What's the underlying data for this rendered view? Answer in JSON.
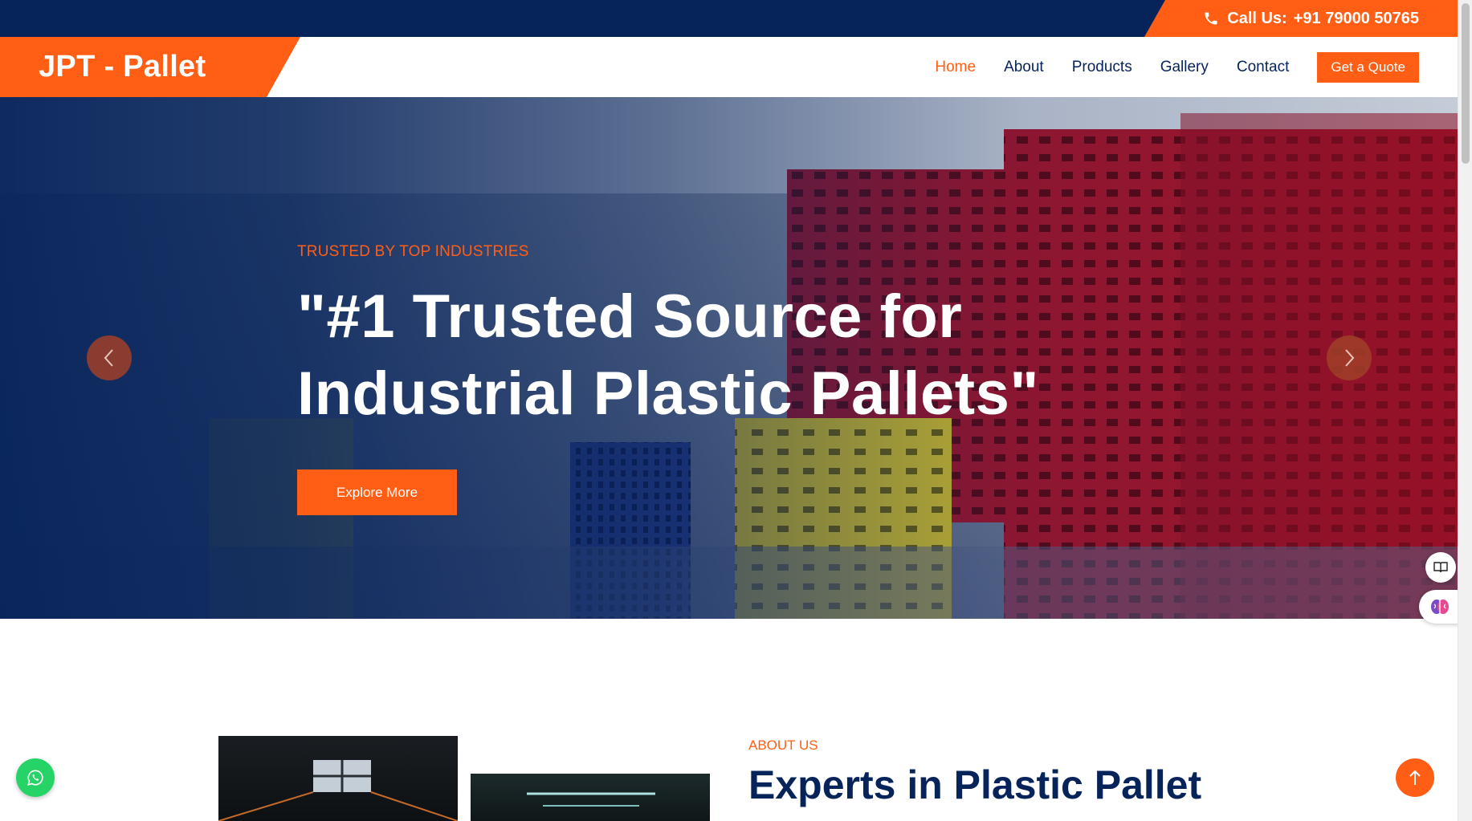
{
  "topbar": {
    "call_label": "Call Us:",
    "phone": "+91 79000 50765",
    "phone_icon": "phone-icon"
  },
  "brand": {
    "name": "JPT - Pallet"
  },
  "nav": {
    "items": [
      {
        "label": "Home",
        "active": true
      },
      {
        "label": "About",
        "active": false
      },
      {
        "label": "Products",
        "active": false
      },
      {
        "label": "Gallery",
        "active": false
      },
      {
        "label": "Contact",
        "active": false
      }
    ],
    "cta": "Get a Quote"
  },
  "hero": {
    "tagline": "TRUSTED BY TOP INDUSTRIES",
    "title_line1": "\"#1 Trusted Source for",
    "title_line2": "Industrial Plastic Pallets\"",
    "button": "Explore More",
    "prev_icon": "chevron-left-icon",
    "next_icon": "chevron-right-icon"
  },
  "about": {
    "tag": "ABOUT US",
    "title": "Experts in Plastic Pallet"
  },
  "widgets": {
    "whatsapp_icon": "whatsapp-icon",
    "back_to_top_icon": "arrow-up-icon",
    "reader_icon": "book-icon",
    "ai_icon": "brain-icon"
  },
  "colors": {
    "navy": "#06235a",
    "orange": "#ff5e14",
    "whatsapp": "#25d366"
  }
}
